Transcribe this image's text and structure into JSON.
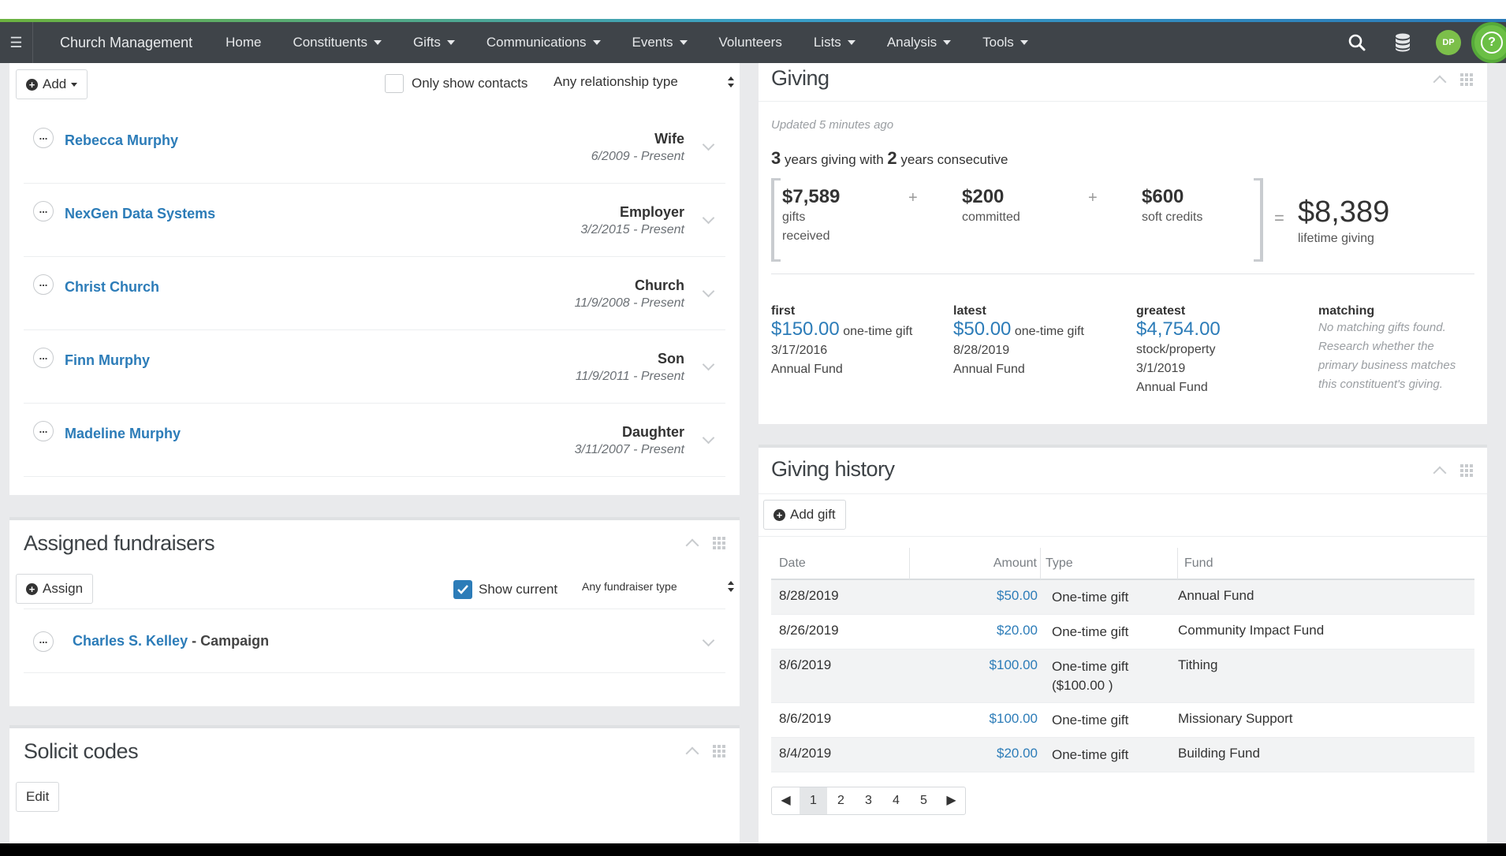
{
  "nav": {
    "brand": "Church Management",
    "items": [
      {
        "label": "Home",
        "caret": false
      },
      {
        "label": "Constituents",
        "caret": true
      },
      {
        "label": "Gifts",
        "caret": true
      },
      {
        "label": "Communications",
        "caret": true
      },
      {
        "label": "Events",
        "caret": true
      },
      {
        "label": "Volunteers",
        "caret": false
      },
      {
        "label": "Lists",
        "caret": true
      },
      {
        "label": "Analysis",
        "caret": true
      },
      {
        "label": "Tools",
        "caret": true
      }
    ],
    "avatar_initials": "DP",
    "help_label": "?"
  },
  "relationships": {
    "add_label": "Add",
    "only_contacts_label": "Only show contacts",
    "relationship_filter": "Any relationship type",
    "rows": [
      {
        "name": "Rebecca Murphy",
        "type": "Wife",
        "dates": "6/2009 - Present"
      },
      {
        "name": "NexGen Data Systems",
        "type": "Employer",
        "dates": "3/2/2015 - Present"
      },
      {
        "name": "Christ Church",
        "type": "Church",
        "dates": "11/9/2008 - Present"
      },
      {
        "name": "Finn Murphy",
        "type": "Son",
        "dates": "11/9/2011 - Present"
      },
      {
        "name": "Madeline Murphy",
        "type": "Daughter",
        "dates": "3/11/2007 - Present"
      }
    ]
  },
  "fundraisers": {
    "title": "Assigned fundraisers",
    "assign_label": "Assign",
    "show_current_label": "Show current",
    "type_filter": "Any fundraiser type",
    "row_name": "Charles S. Kelley",
    "row_role": "- Campaign"
  },
  "solicit": {
    "title": "Solicit codes",
    "edit_label": "Edit"
  },
  "giving": {
    "title": "Giving",
    "updated": "Updated 5 minutes ago",
    "years_num": "3",
    "years_text": "years giving with",
    "consec_num": "2",
    "consec_text": "years consecutive",
    "received_amount": "$7,589",
    "received_label1": "gifts",
    "received_label2": "received",
    "committed_amount": "$200",
    "committed_label": "committed",
    "soft_amount": "$600",
    "soft_label": "soft credits",
    "plus": "+",
    "equals": "=",
    "lifetime_amount": "$8,389",
    "lifetime_label": "lifetime giving",
    "first": {
      "label": "first",
      "amount": "$150.00",
      "kind": "one-time gift",
      "date": "3/17/2016",
      "fund": "Annual Fund"
    },
    "latest": {
      "label": "latest",
      "amount": "$50.00",
      "kind": "one-time gift",
      "date": "8/28/2019",
      "fund": "Annual Fund"
    },
    "greatest": {
      "label": "greatest",
      "amount": "$4,754.00",
      "kind": "stock/property",
      "date": "3/1/2019",
      "fund": "Annual Fund"
    },
    "matching": {
      "label": "matching",
      "line1": "No matching gifts found.",
      "line2": "Research whether the",
      "line3": "primary business matches",
      "line4": "this constituent's giving."
    }
  },
  "history": {
    "title": "Giving history",
    "add_label": "Add gift",
    "columns": {
      "date": "Date",
      "amount": "Amount",
      "type": "Type",
      "fund": "Fund"
    },
    "rows": [
      {
        "date": "8/28/2019",
        "amount": "$50.00",
        "type": "One-time gift",
        "type2": "",
        "fund": "Annual Fund"
      },
      {
        "date": "8/26/2019",
        "amount": "$20.00",
        "type": "One-time gift",
        "type2": "",
        "fund": "Community Impact Fund"
      },
      {
        "date": "8/6/2019",
        "amount": "$100.00",
        "type": "One-time gift",
        "type2": "($100.00 )",
        "fund": "Tithing"
      },
      {
        "date": "8/6/2019",
        "amount": "$100.00",
        "type": "One-time gift",
        "type2": "",
        "fund": "Missionary Support"
      },
      {
        "date": "8/4/2019",
        "amount": "$20.00",
        "type": "One-time gift",
        "type2": "",
        "fund": "Building Fund"
      }
    ],
    "pages": [
      "1",
      "2",
      "3",
      "4",
      "5"
    ],
    "current_page": "1"
  }
}
